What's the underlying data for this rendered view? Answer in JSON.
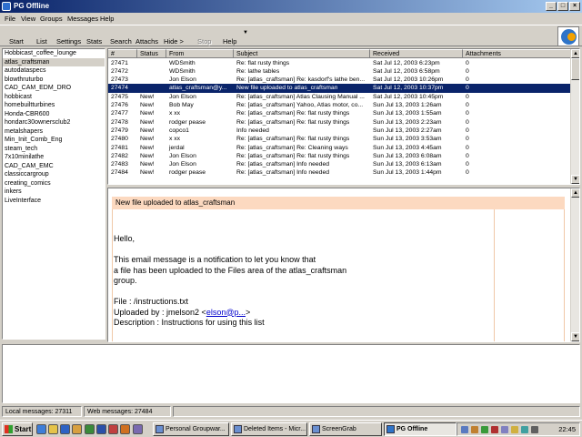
{
  "window": {
    "title": "PG Offline"
  },
  "menu": [
    "File",
    "View",
    "Groups",
    "Messages",
    "Help"
  ],
  "toolbar": {
    "start": "Start",
    "list": "List",
    "settings": "Settings",
    "stats": "Stats",
    "search": "Search",
    "attachs": "Attachs",
    "hide": "Hide >",
    "stop": "Stop",
    "help": "Help"
  },
  "groups": [
    "Hobbicast_coffee_lounge",
    "atlas_craftsman",
    "autodataspecs",
    "blowthruturbo",
    "CAD_CAM_EDM_DRO",
    "hobbicast",
    "homebuiltturbines",
    "Honda-CBR600",
    "hondarc30ownersclub2",
    "metalshapers",
    "Min_Init_Comb_Eng",
    "steam_tech",
    "7x10minilathe",
    "CAD_CAM_EMC",
    "classiccargroup",
    "creating_comics",
    "inkers",
    "LiveInterface"
  ],
  "table": {
    "headers": {
      "num": "#",
      "status": "Status",
      "from": "From",
      "subject": "Subject",
      "received": "Received",
      "attachments": "Attachments"
    },
    "rows": [
      {
        "num": "27471",
        "status": "",
        "from": "WDSmith",
        "subject": "Re: flat rusty things",
        "received": "Sat Jul 12, 2003  6:23pm",
        "att": "0"
      },
      {
        "num": "27472",
        "status": "",
        "from": "WDSmith",
        "subject": "Re: lathe tables",
        "received": "Sat Jul 12, 2003  6:58pm",
        "att": "0"
      },
      {
        "num": "27473",
        "status": "",
        "from": "Jon Elson",
        "subject": "Re: [atlas_craftsman] Re: kasdorf's lathe ben...",
        "received": "Sat Jul 12, 2003 10:26pm",
        "att": "0"
      },
      {
        "num": "27474",
        "status": "",
        "from": "atlas_craftsman@y...",
        "subject": "New file uploaded to atlas_craftsman",
        "received": "Sat Jul 12, 2003 10:37pm",
        "att": "0",
        "selected": true
      },
      {
        "num": "27475",
        "status": "New!",
        "from": "Jon Elson",
        "subject": "Re: [atlas_craftsman] Atlas Clausing Manual ...",
        "received": "Sat Jul 12, 2003 10:45pm",
        "att": "0"
      },
      {
        "num": "27476",
        "status": "New!",
        "from": "Bob May",
        "subject": "Re: [atlas_craftsman] Yahoo, Atlas motor, co...",
        "received": "Sun Jul 13, 2003  1:26am",
        "att": "0"
      },
      {
        "num": "27477",
        "status": "New!",
        "from": "x xx",
        "subject": "Re: [atlas_craftsman] Re: flat rusty things",
        "received": "Sun Jul 13, 2003  1:55am",
        "att": "0"
      },
      {
        "num": "27478",
        "status": "New!",
        "from": "rodger pease",
        "subject": "Re: [atlas_craftsman] Re: flat rusty things",
        "received": "Sun Jul 13, 2003  2:23am",
        "att": "0"
      },
      {
        "num": "27479",
        "status": "New!",
        "from": "copco1",
        "subject": "Info needed",
        "received": "Sun Jul 13, 2003  2:27am",
        "att": "0"
      },
      {
        "num": "27480",
        "status": "New!",
        "from": "x xx",
        "subject": "Re: [atlas_craftsman] Re: flat rusty things",
        "received": "Sun Jul 13, 2003  3:53am",
        "att": "0"
      },
      {
        "num": "27481",
        "status": "New!",
        "from": "jerdal",
        "subject": "Re: [atlas_craftsman] Re: Cleaning ways",
        "received": "Sun Jul 13, 2003  4:45am",
        "att": "0"
      },
      {
        "num": "27482",
        "status": "New!",
        "from": "Jon Elson",
        "subject": "Re: [atlas_craftsman] Re: flat rusty things",
        "received": "Sun Jul 13, 2003  6:08am",
        "att": "0"
      },
      {
        "num": "27483",
        "status": "New!",
        "from": "Jon Elson",
        "subject": "Re: [atlas_craftsman] Info needed",
        "received": "Sun Jul 13, 2003  6:13am",
        "att": "0"
      },
      {
        "num": "27484",
        "status": "New!",
        "from": "rodger pease",
        "subject": "Re: [atlas_craftsman] Info needed",
        "received": "Sun Jul 13, 2003  1:44pm",
        "att": "0"
      }
    ]
  },
  "preview": {
    "subject": "New file uploaded to atlas_craftsman",
    "greeting": "Hello,",
    "line1": "This email message is a notification to let you know that",
    "line2": "a file has been uploaded to the Files area of the atlas_craftsman",
    "line3": "group.",
    "file": "File : /instructions.txt",
    "uploaded_prefix": "Uploaded by : jmelson2 <",
    "uploaded_link": "elson@p...",
    "uploaded_suffix": ">",
    "description": "Description : Instructions for using this list"
  },
  "status": {
    "local": "Local messages: 27311",
    "web": "Web messages: 27484"
  },
  "taskbar": {
    "start": "Start",
    "tasks": [
      "Personal Groupwar...",
      "Deleted Items - Micr...",
      "ScreenGrab",
      "PG Offline"
    ],
    "clock": "22:45"
  },
  "colors": {
    "titlebar": "#0a246a",
    "selection": "#0a246a",
    "preview_header": "#fcd9c0",
    "link": "#0000cc"
  }
}
